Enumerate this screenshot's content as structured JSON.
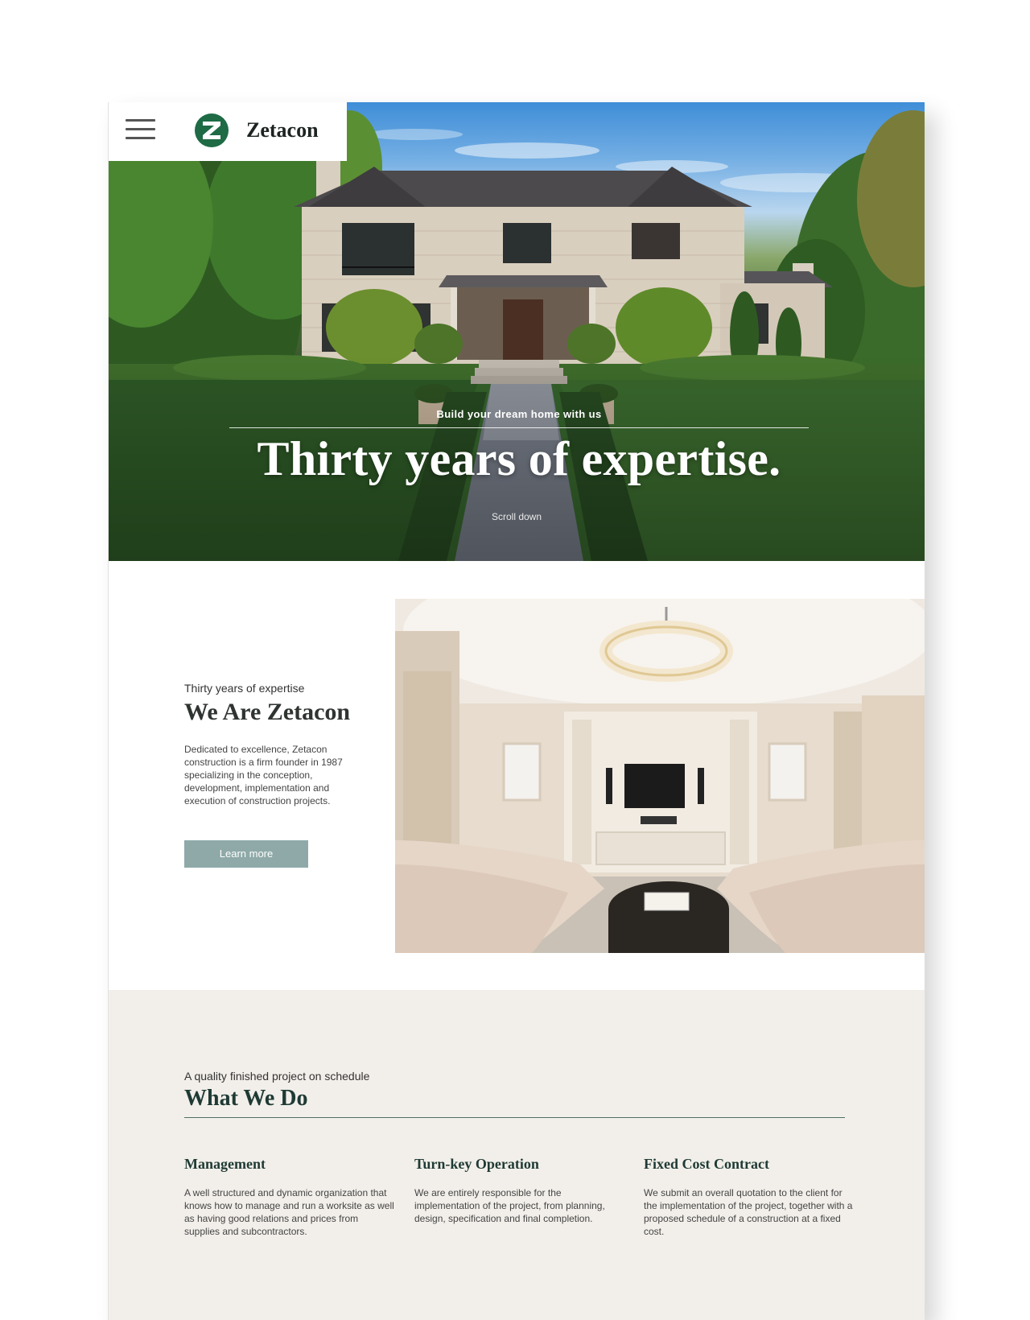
{
  "brand": {
    "name": "Zetacon",
    "logo_letter": "Z",
    "logo_color": "#1e6b45"
  },
  "nav": {
    "menu_icon": "hamburger-menu-icon"
  },
  "hero": {
    "kicker": "Build your dream home with us",
    "headline": "Thirty years of expertise.",
    "scroll_label": "Scroll down"
  },
  "about": {
    "eyebrow": "Thirty years of expertise",
    "title": "We Are Zetacon",
    "body": "Dedicated to excellence, Zetacon construction is a firm founder in 1987 specializing in the conception, development, implementation and execution of construction projects.",
    "cta_label": "Learn more",
    "cta_color": "#8ea9a8"
  },
  "services": {
    "eyebrow": "A quality finished project on schedule",
    "title": "What We Do",
    "background": "#f2efea",
    "items": [
      {
        "title": "Management",
        "body": "A well structured and dynamic organization that knows how to manage and run a worksite as well as having good relations and prices from supplies and subcontractors."
      },
      {
        "title": "Turn-key Operation",
        "body": "We are entirely responsible for the implementation of the project, from planning, design, specification and final completion."
      },
      {
        "title": "Fixed Cost Contract",
        "body": "We submit an overall quotation to the client for the implementation of the project, together with a proposed schedule of a construction at a fixed cost."
      }
    ]
  }
}
